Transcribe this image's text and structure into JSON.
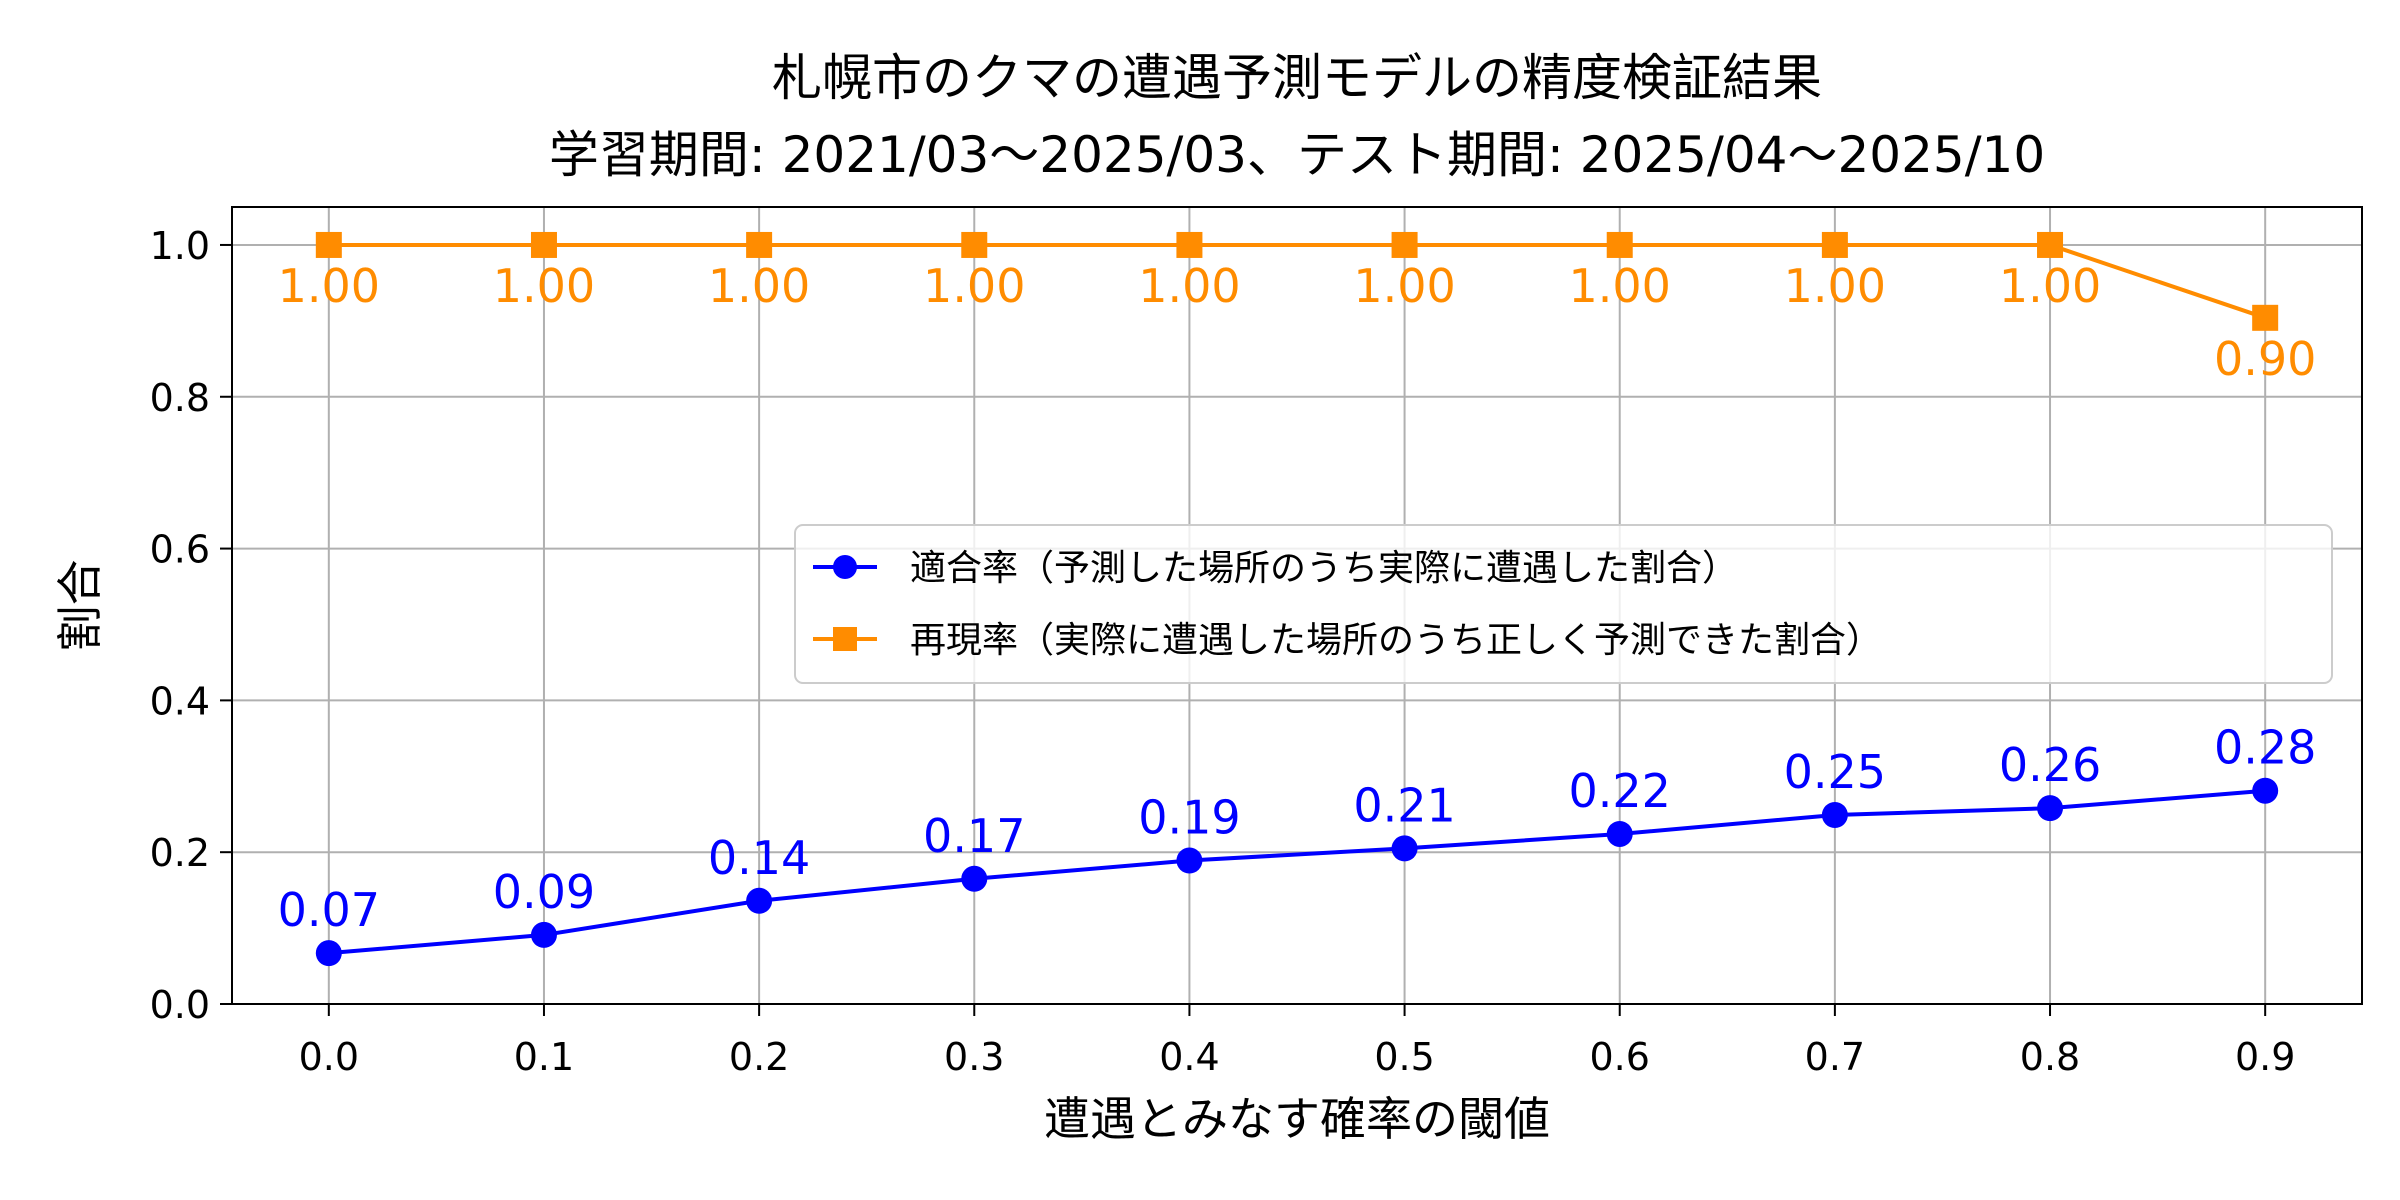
{
  "chart_data": {
    "type": "line",
    "title": "札幌市のクマの遭遇予測モデルの精度検証結果",
    "subtitle": "学習期間: 2021/03〜2025/03、テスト期間: 2025/04〜2025/10",
    "xlabel": "遭遇とみなす確率の閾値",
    "ylabel": "割合",
    "x": [
      0.0,
      0.1,
      0.2,
      0.3,
      0.4,
      0.5,
      0.6,
      0.7,
      0.8,
      0.9
    ],
    "x_tick_labels": [
      "0.0",
      "0.1",
      "0.2",
      "0.3",
      "0.4",
      "0.5",
      "0.6",
      "0.7",
      "0.8",
      "0.9"
    ],
    "y_tick_labels": [
      "0.0",
      "0.2",
      "0.4",
      "0.6",
      "0.8",
      "1.0"
    ],
    "y_ticks": [
      0.0,
      0.2,
      0.4,
      0.6,
      0.8,
      1.0
    ],
    "xlim": [
      -0.045,
      0.945
    ],
    "ylim": [
      0.0,
      1.05
    ],
    "grid": true,
    "legend_position": "center-right",
    "series": [
      {
        "name": "適合率（予測した場所のうち実際に遭遇した割合）",
        "color": "#0000ff",
        "marker": "circle",
        "values": [
          0.067,
          0.091,
          0.136,
          0.165,
          0.189,
          0.205,
          0.224,
          0.249,
          0.258,
          0.281
        ],
        "labels": [
          "0.07",
          "0.09",
          "0.14",
          "0.17",
          "0.19",
          "0.21",
          "0.22",
          "0.25",
          "0.26",
          "0.28"
        ],
        "label_position": "above"
      },
      {
        "name": "再現率（実際に遭遇した場所のうち正しく予測できた割合）",
        "color": "#ff8c00",
        "marker": "square",
        "values": [
          1.0,
          1.0,
          1.0,
          1.0,
          1.0,
          1.0,
          1.0,
          1.0,
          1.0,
          0.904
        ],
        "labels": [
          "1.00",
          "1.00",
          "1.00",
          "1.00",
          "1.00",
          "1.00",
          "1.00",
          "1.00",
          "1.00",
          "0.90"
        ],
        "label_position": "below"
      }
    ]
  }
}
